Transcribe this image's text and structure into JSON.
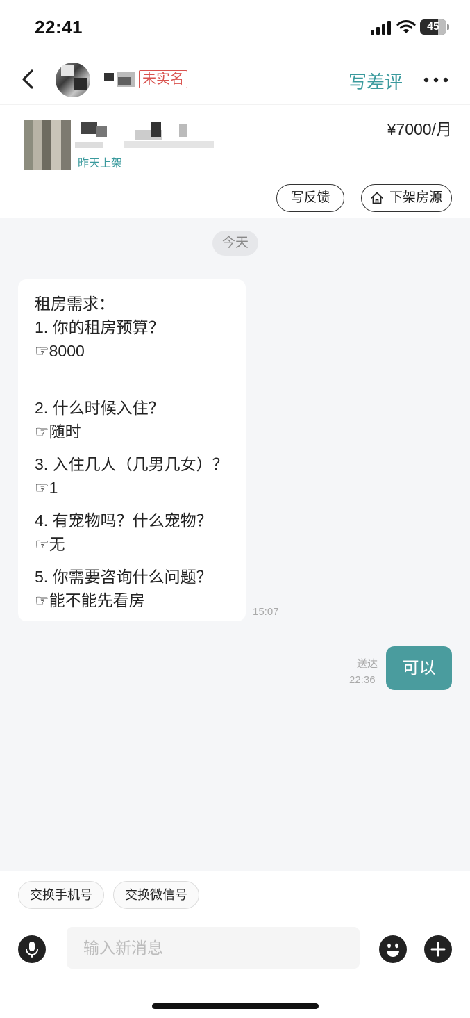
{
  "status_bar": {
    "time": "22:41",
    "battery": "45"
  },
  "header": {
    "anon_badge": "未实名",
    "bad_review": "写差评"
  },
  "listing": {
    "price": "¥7000/月",
    "listed_time": "昨天上架",
    "feedback_label": "写反馈",
    "delist_label": "下架房源"
  },
  "chat": {
    "date_divider": "今天",
    "incoming": {
      "lines": [
        "租房需求：",
        "1. 你的租房预算？",
        "☞8000",
        "2. 什么时候入住？",
        "☞随时",
        "3. 入住几人（几男几女）？",
        "☞1",
        "4. 有宠物吗？什么宠物？",
        "☞无",
        "5. 你需要咨询什么问题？",
        "☞能不能先看房"
      ],
      "time": "15:07"
    },
    "outgoing": {
      "text": "可以",
      "status": "送达",
      "time": "22:36"
    }
  },
  "composer": {
    "quick_replies": [
      "交换手机号",
      "交换微信号"
    ],
    "placeholder": "输入新消息"
  },
  "colors": {
    "accent": "#4a9c9e",
    "alert": "#d9534f",
    "chat_bg": "#f5f6f8"
  },
  "icons": [
    "back-icon",
    "more-icon",
    "house-icon",
    "mic-icon",
    "emoji-icon",
    "plus-icon",
    "signal-icon",
    "wifi-icon"
  ]
}
